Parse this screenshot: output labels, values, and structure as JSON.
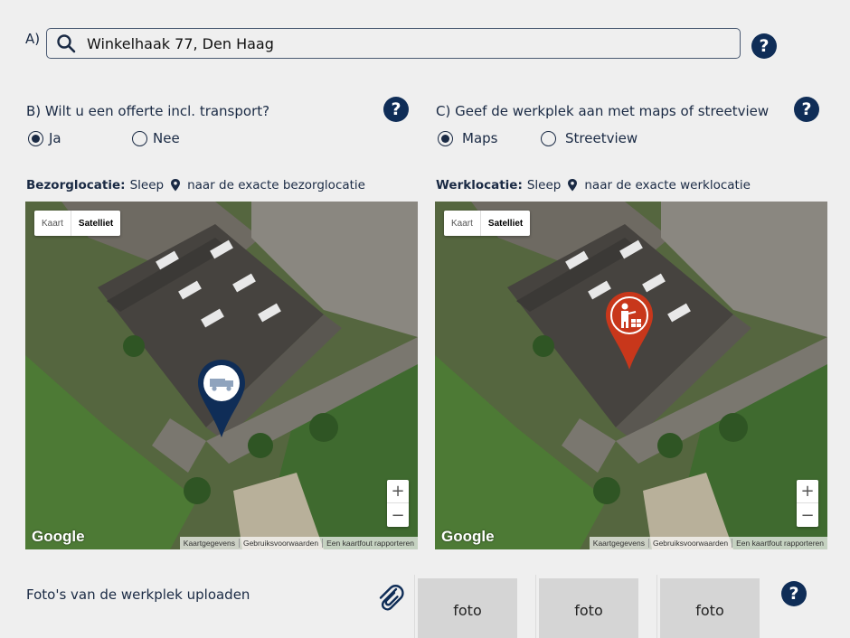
{
  "address": {
    "label": "A)",
    "value": "Winkelhaak 77, Den Haag"
  },
  "transport": {
    "question": "B) Wilt u een offerte incl. transport?",
    "options": [
      "Ja",
      "Nee"
    ],
    "selected": "Ja"
  },
  "workplace": {
    "question": "C) Geef de werkplek aan met maps of streetview",
    "options": [
      "Maps",
      "Streetview"
    ],
    "selected": "Maps"
  },
  "delivery_map": {
    "hint_bold": "Bezorglocatie:",
    "hint_pre": "Sleep",
    "hint_post": "naar de exacte bezorglocatie",
    "marker_color": "#0f2d57"
  },
  "work_map": {
    "hint_bold": "Werklocatie:",
    "hint_pre": "Sleep",
    "hint_post": "naar de exacte werklocatie",
    "marker_color": "#c8371b"
  },
  "map_controls": {
    "map_label": "Kaart",
    "satellite_label": "Satelliet",
    "zoom_in": "+",
    "zoom_out": "−",
    "logo": "Google",
    "attribution": [
      "Kaartgegevens",
      "Gebruiksvoorwaarden",
      "Een kaartfout rapporteren"
    ]
  },
  "upload": {
    "label": "Foto's van de werkplek uploaden",
    "photo_slots": [
      "foto",
      "foto",
      "foto"
    ]
  },
  "help_symbol": "?",
  "colors": {
    "primary": "#0f2d57",
    "accent_red": "#c8371b",
    "background": "#efefef"
  }
}
